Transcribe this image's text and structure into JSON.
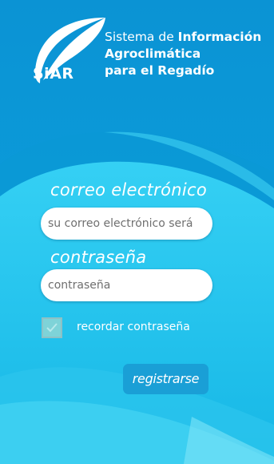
{
  "header": {
    "logo_text": "SiAR",
    "title_line1_light": "Sistema de ",
    "title_line1_bold": "Información",
    "title_line2": "Agroclimática",
    "title_line3": "para el Regadío"
  },
  "form": {
    "email_label": "correo electrónico",
    "email_placeholder": "su correo electrónico será",
    "password_label": "contraseña",
    "password_placeholder": "contraseña",
    "remember_label": "recordar contraseña",
    "remember_checked": false,
    "register_button": "registrarse"
  },
  "icons": {
    "logo": "leaf-logo-icon",
    "checkbox_mark": "checkmark-icon"
  },
  "colors": {
    "primary_blue": "#0a9fdc",
    "button_blue": "#1a9fd6",
    "light_cyan": "#28c6ef",
    "white": "#ffffff"
  }
}
